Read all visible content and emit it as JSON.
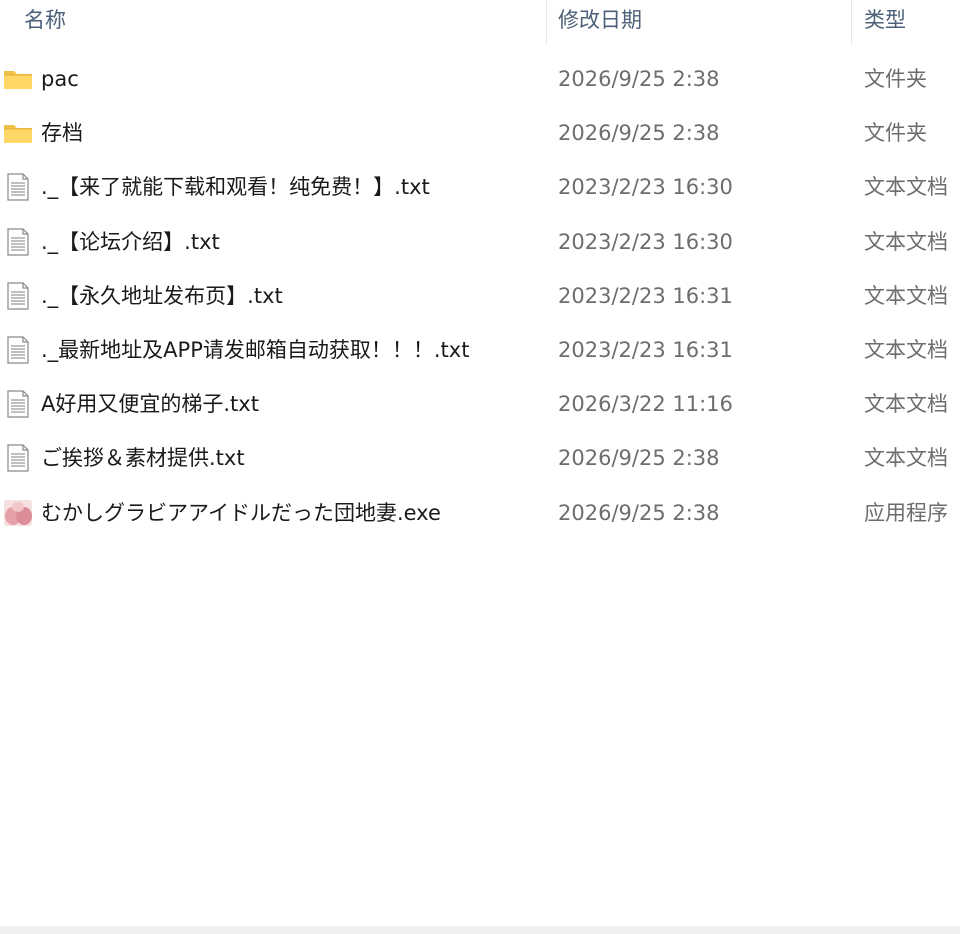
{
  "columns": {
    "name": "名称",
    "date": "修改日期",
    "type": "类型"
  },
  "files": [
    {
      "name": "pac",
      "date": "2026/9/25 2:38",
      "type": "文件夹",
      "icon": "folder-icon"
    },
    {
      "name": "存档",
      "date": "2026/9/25 2:38",
      "type": "文件夹",
      "icon": "folder-icon"
    },
    {
      "name": "._【来了就能下载和观看！纯免费！】.txt",
      "date": "2023/2/23 16:30",
      "type": "文本文档",
      "icon": "text-file-icon"
    },
    {
      "name": "._【论坛介绍】.txt",
      "date": "2023/2/23 16:30",
      "type": "文本文档",
      "icon": "text-file-icon"
    },
    {
      "name": "._【永久地址发布页】.txt",
      "date": "2023/2/23 16:31",
      "type": "文本文档",
      "icon": "text-file-icon"
    },
    {
      "name": "._最新地址及APP请发邮箱自动获取！！！.txt",
      "date": "2023/2/23 16:31",
      "type": "文本文档",
      "icon": "text-file-icon"
    },
    {
      "name": "A好用又便宜的梯子.txt",
      "date": "2026/3/22 11:16",
      "type": "文本文档",
      "icon": "text-file-icon"
    },
    {
      "name": "ご挨拶＆素材提供.txt",
      "date": "2026/9/25 2:38",
      "type": "文本文档",
      "icon": "text-file-icon"
    },
    {
      "name": "むかしグラビアアイドルだった団地妻.exe",
      "date": "2026/9/25 2:38",
      "type": "应用程序",
      "icon": "application-icon"
    }
  ]
}
